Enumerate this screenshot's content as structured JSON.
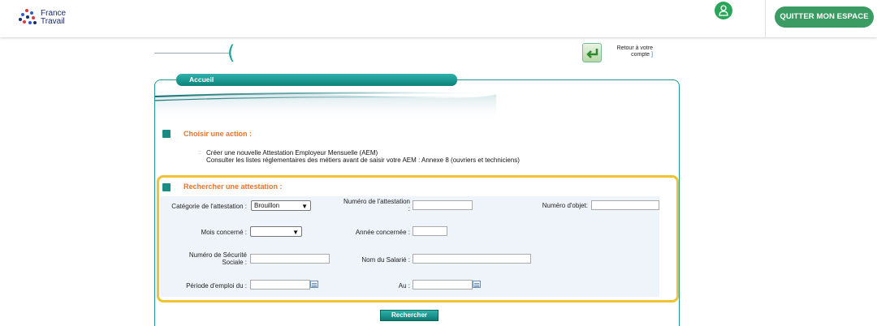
{
  "header": {
    "logo_line1": "France",
    "logo_line2": "Travail",
    "quit_label": "QUITTER MON ESPACE",
    "user_icon": "user-icon",
    "brand_color": "#3a9b63"
  },
  "nav": {
    "retour_line1": "Retour à votre",
    "retour_line2": "compte",
    "retour_bracket": "]",
    "tab_label": "Accueil"
  },
  "actions": {
    "title": "Choisir une action :",
    "bullet": "::",
    "create_label": "Créer une nouvelle Attestation Employeur Mensuelle (AEM)",
    "consult_label": "Consulter les listes réglementaires des métiers avant de saisir votre AEM :  Annexe 8 (ouvriers et techniciens)"
  },
  "search": {
    "title": "Rechercher une attestation :",
    "categorie_label": "Catégorie de l'attestation :",
    "categorie_value": "Brouillon",
    "numero_attestation_label_1": "Numéro de l'attestation",
    "numero_attestation_label_2": ":",
    "numero_objet_label": "Numéro d'objet:",
    "mois_label": "Mois concerné :",
    "mois_value": "",
    "annee_label": "Année concernée :",
    "nss_label_1": "Numéro de Sécurité",
    "nss_label_2": "Sociale :",
    "nom_label": "Nom du Salarié :",
    "periode_label": "Période d'emploi du :",
    "au_label": "Au :",
    "submit_label": "Rechercher"
  },
  "colors": {
    "accent_teal": "#1a9b95",
    "section_orange": "#e8742a",
    "highlight_yellow": "#f1c232"
  }
}
